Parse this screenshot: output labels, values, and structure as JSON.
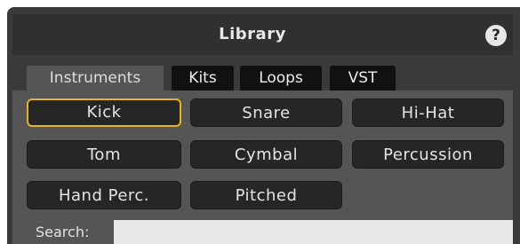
{
  "panel": {
    "title": "Library",
    "help_label": "?"
  },
  "tabs": [
    {
      "label": "Instruments",
      "active": true
    },
    {
      "label": "Kits",
      "active": false
    },
    {
      "label": "Loops",
      "active": false
    },
    {
      "label": "VST",
      "active": false
    }
  ],
  "categories": [
    {
      "label": "Kick",
      "selected": true
    },
    {
      "label": "Snare",
      "selected": false
    },
    {
      "label": "Hi-Hat",
      "selected": false
    },
    {
      "label": "Tom",
      "selected": false
    },
    {
      "label": "Cymbal",
      "selected": false
    },
    {
      "label": "Percussion",
      "selected": false
    },
    {
      "label": "Hand Perc.",
      "selected": false
    },
    {
      "label": "Pitched",
      "selected": false
    }
  ],
  "search": {
    "label": "Search:",
    "value": ""
  },
  "colors": {
    "selected_outline": "#e3b620",
    "panel_background": "#555555",
    "button_background": "#262626"
  }
}
